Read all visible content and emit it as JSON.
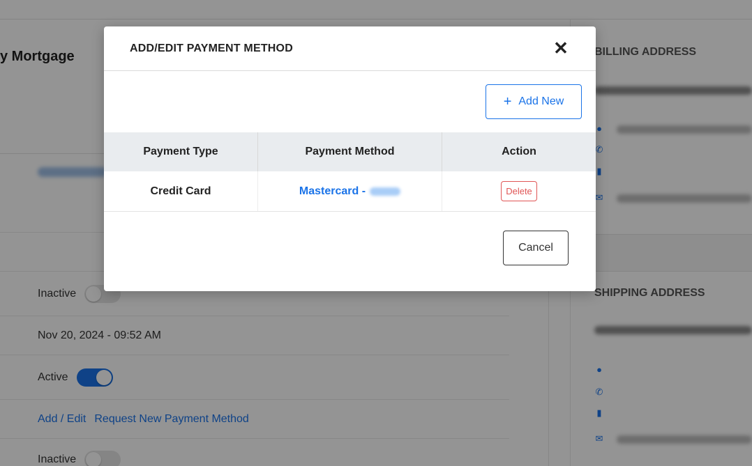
{
  "background": {
    "left_title": "y Mortgage",
    "rows": [
      {
        "status": "Inactive"
      },
      {
        "timestamp": "Nov 20, 2024 - 09:52 AM"
      },
      {
        "status": "Active"
      },
      {
        "links": [
          "Add / Edit",
          "Request New Payment Method"
        ]
      },
      {
        "status": "Inactive"
      }
    ],
    "billing_heading": "BILLING ADDRESS",
    "shipping_heading": "SHIPPING ADDRESS"
  },
  "modal": {
    "title": "ADD/EDIT PAYMENT METHOD",
    "close_glyph": "✕",
    "add_new_label": "Add New",
    "plus_glyph": "+",
    "table": {
      "headers": [
        "Payment Type",
        "Payment Method",
        "Action"
      ],
      "rows": [
        {
          "type": "Credit Card",
          "method": "Mastercard -",
          "action": "Delete"
        }
      ]
    },
    "cancel_label": "Cancel"
  },
  "icons": {
    "location": "location-pin-icon",
    "phone": "phone-icon",
    "mobile": "mobile-icon",
    "email": "email-icon",
    "close": "close-icon",
    "plus": "plus-icon"
  },
  "colors": {
    "accent": "#1a73e8",
    "danger": "#e05555",
    "overlay": "rgba(0,0,0,0.42)"
  }
}
